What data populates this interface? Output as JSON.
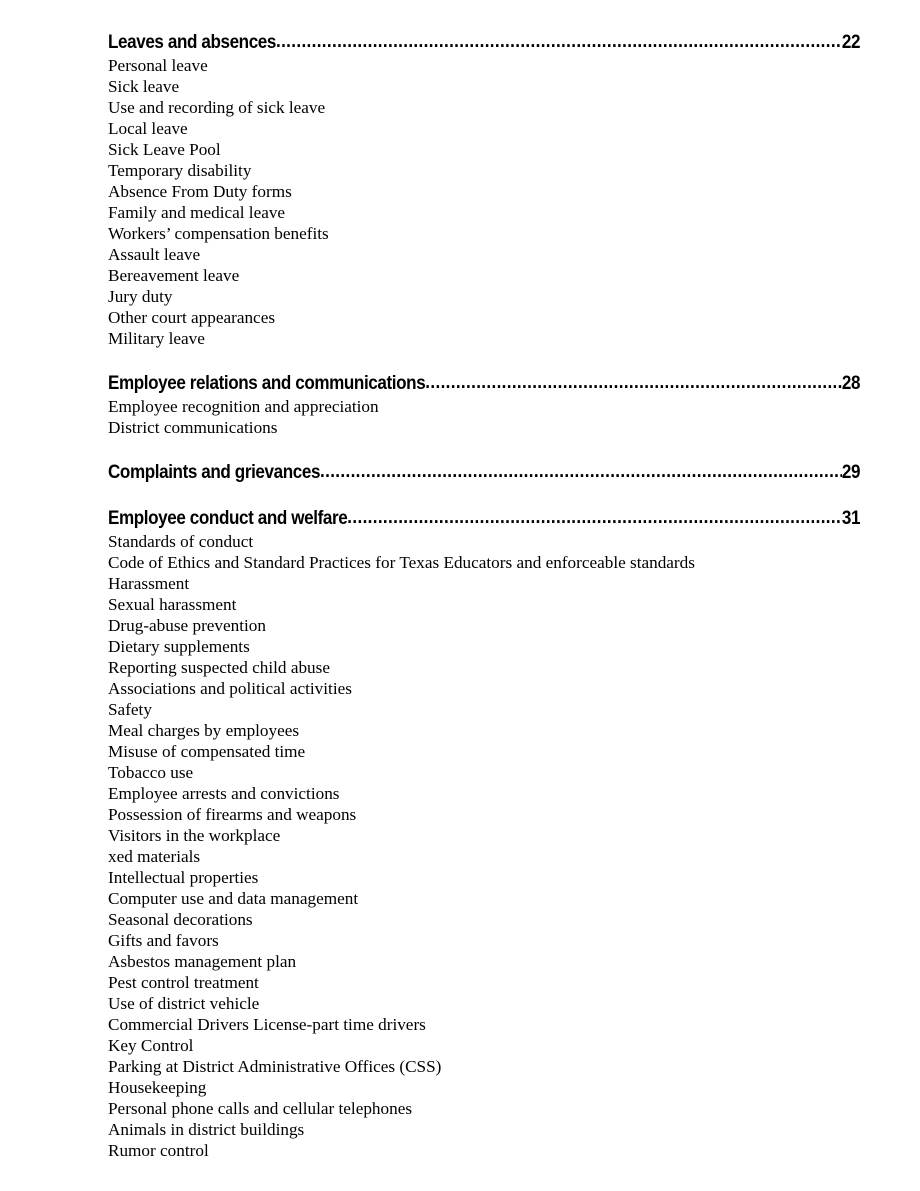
{
  "document": {
    "type": "table-of-contents",
    "leader_char": "."
  },
  "sections": [
    {
      "title": "Leaves and absences",
      "page": "22",
      "entries": [
        "Personal leave",
        "Sick leave",
        "Use and recording of sick leave",
        "Local leave",
        "Sick Leave Pool",
        "Temporary disability",
        "Absence From Duty forms",
        "Family and medical leave",
        "Workers’ compensation benefits",
        "Assault leave",
        "Bereavement leave",
        "Jury duty",
        "Other court appearances",
        "Military leave"
      ]
    },
    {
      "title": "Employee relations and communications",
      "page": "28",
      "entries": [
        "Employee recognition and appreciation",
        "District communications"
      ]
    },
    {
      "title": "Complaints and grievances",
      "page": "29",
      "entries": []
    },
    {
      "title": "Employee conduct and welfare",
      "page": "31",
      "entries": [
        "Standards of conduct",
        "Code of Ethics and Standard Practices for Texas Educators and enforceable standards",
        "Harassment",
        "Sexual harassment",
        "Drug-abuse prevention",
        "Dietary supplements",
        "Reporting suspected child abuse",
        "Associations and political activities",
        "Safety",
        "Meal charges by employees",
        "Misuse of compensated time",
        "Tobacco use",
        "Employee arrests and convictions",
        "Possession of firearms and weapons",
        "Visitors in the workplace",
        "xed materials",
        "Intellectual properties",
        "Computer use and data management",
        "Seasonal decorations",
        "Gifts and favors",
        "Asbestos management plan",
        "Pest control treatment",
        "Use of district vehicle",
        "Commercial Drivers License-part time drivers",
        "Key Control",
        "Parking at District Administrative Offices (CSS)",
        "Housekeeping",
        "Personal phone calls and cellular telephones",
        "Animals in district buildings",
        "Rumor control"
      ]
    }
  ]
}
